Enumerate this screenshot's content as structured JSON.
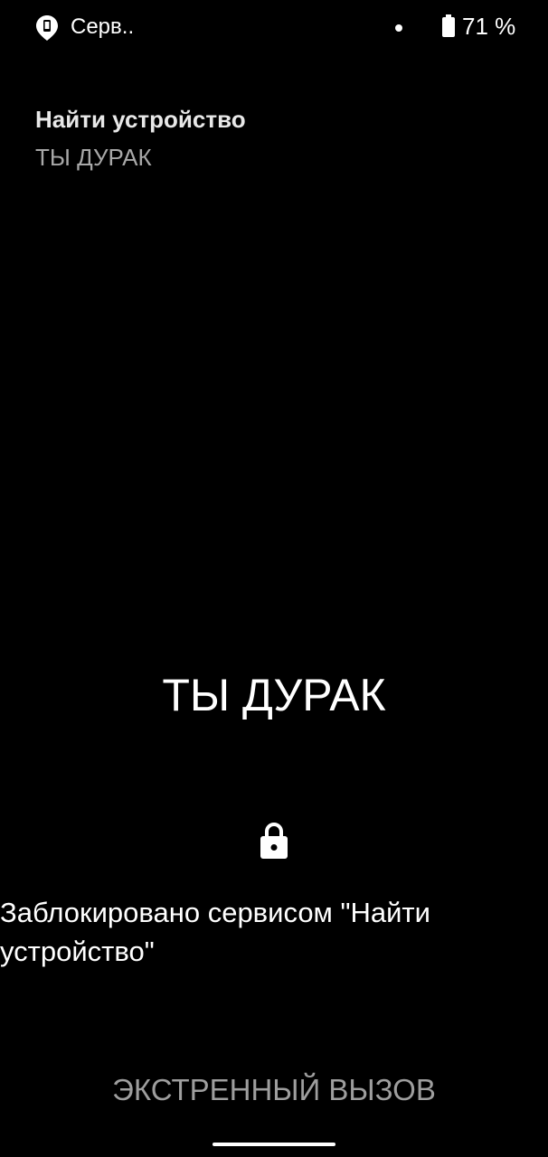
{
  "status_bar": {
    "notification_icon": "find-device-icon",
    "carrier": "Серв..",
    "battery_icon": "battery-icon",
    "battery_percent": "71 %"
  },
  "notification": {
    "title": "Найти устройство",
    "subtitle": "ТЫ ДУРАК"
  },
  "lockscreen": {
    "message": "ТЫ ДУРАК",
    "lock_icon": "lock-icon",
    "locked_by": "Заблокировано сервисом \"Найти устройство\"",
    "emergency_label": "ЭКСТРЕННЫЙ ВЫЗОВ"
  },
  "colors": {
    "background": "#000000",
    "text_primary": "#ffffff",
    "text_secondary": "#a8a8a8",
    "button_text": "#9e9e9e"
  }
}
